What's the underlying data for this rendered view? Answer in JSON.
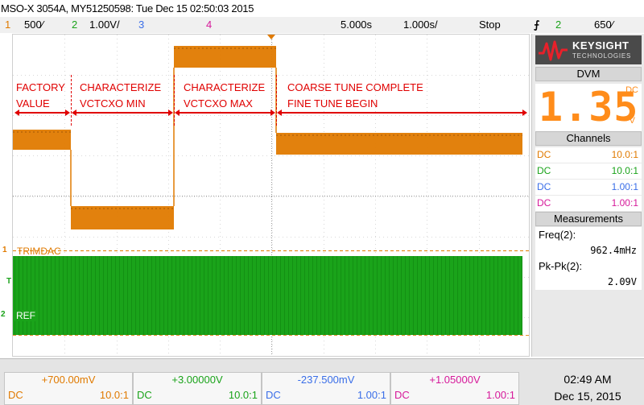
{
  "title": "MSO-X 3054A, MY51250598: Tue Dec 15 02:50:03 2015",
  "status_bar": {
    "ch1_num": "1",
    "ch1_scale": "500∕",
    "ch2_num": "2",
    "ch2_scale": "1.00V/",
    "ch3_num": "3",
    "ch4_num": "4",
    "time_ref": "5.000s",
    "time_scale": "1.000s/",
    "run_state": "Stop",
    "trigger_symbol": "⨍",
    "trigger_source": "2",
    "trigger_level": "650∕"
  },
  "screen": {
    "annotations": [
      {
        "text": "FACTORY\nVALUE"
      },
      {
        "text": "CHARACTERIZE\nVCTCXO MIN"
      },
      {
        "text": "CHARACTERIZE\nVCTCXO MAX"
      },
      {
        "text": "COARSE TUNE COMPLETE\nFINE TUNE BEGIN"
      }
    ],
    "ch1_label": "TRIMDAC",
    "ch2_label": "REF",
    "ch1_marker": "1",
    "ch2_marker": "2",
    "trigger_marker": "T"
  },
  "side_panel": {
    "logo_brand": "KEYSIGHT",
    "logo_tech": "TECHNOLOGIES",
    "dvm_header": "DVM",
    "dvm_value": "1.35",
    "dvm_coupling": "DC",
    "dvm_unit": "V",
    "channels_header": "Channels",
    "channels": [
      {
        "coupling": "DC",
        "probe": "10.0:1",
        "color": "#e07a00"
      },
      {
        "coupling": "DC",
        "probe": "10.0:1",
        "color": "#1aa31a"
      },
      {
        "coupling": "DC",
        "probe": "1.00:1",
        "color": "#3a6ee8"
      },
      {
        "coupling": "DC",
        "probe": "1.00:1",
        "color": "#d6199a"
      }
    ],
    "measurements_header": "Measurements",
    "meas1_label": "Freq(2):",
    "meas1_value": "962.4mHz",
    "meas2_label": "Pk-Pk(2):",
    "meas2_value": "2.09V"
  },
  "bottom_bar": {
    "channels": [
      {
        "offset": "+700.00mV",
        "coupling": "DC",
        "probe": "10.0:1",
        "color": "#e07a00"
      },
      {
        "offset": "+3.00000V",
        "coupling": "DC",
        "probe": "10.0:1",
        "color": "#1aa31a"
      },
      {
        "offset": "-237.500mV",
        "coupling": "DC",
        "probe": "1.00:1",
        "color": "#3a6ee8"
      },
      {
        "offset": "+1.05000V",
        "coupling": "DC",
        "probe": "1.00:1",
        "color": "#d6199a"
      }
    ],
    "time": "02:49 AM",
    "date": "Dec 15, 2015"
  },
  "colors": {
    "ch1": "#e07a00",
    "ch2": "#1aa31a",
    "ch3": "#3a6ee8",
    "ch4": "#d6199a",
    "annotation": "#e00000"
  }
}
